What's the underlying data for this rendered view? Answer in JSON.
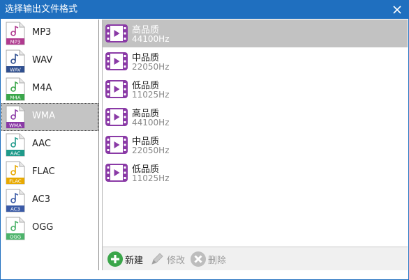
{
  "window": {
    "title": "选择输出文件格式"
  },
  "formats": [
    {
      "label": "MP3",
      "badge": "MP3",
      "color": "#b03a8f"
    },
    {
      "label": "WAV",
      "badge": "WAV",
      "color": "#2f4f8f"
    },
    {
      "label": "M4A",
      "badge": "M4A",
      "color": "#3aa64a"
    },
    {
      "label": "WMA",
      "badge": "WMA",
      "color": "#8a3aa6",
      "selected": true
    },
    {
      "label": "AAC",
      "badge": "AAC",
      "color": "#1f9a8a"
    },
    {
      "label": "FLAC",
      "badge": "FLAC",
      "color": "#e8a900"
    },
    {
      "label": "AC3",
      "badge": "AC3",
      "color": "#3a5aa6"
    },
    {
      "label": "OGG",
      "badge": "OGG",
      "color": "#4cb36a"
    }
  ],
  "presets": [
    {
      "name": "高品质",
      "rate": "44100Hz",
      "selected": true
    },
    {
      "name": "中品质",
      "rate": "22050Hz"
    },
    {
      "name": "低品质",
      "rate": "11025Hz"
    },
    {
      "name": "高品质",
      "rate": "44100Hz"
    },
    {
      "name": "中品质",
      "rate": "22050Hz"
    },
    {
      "name": "低品质",
      "rate": "11025Hz"
    }
  ],
  "toolbar": {
    "new_label": "新建",
    "edit_label": "修改",
    "delete_label": "删除"
  },
  "colors": {
    "titlebar": "#1f6fbf",
    "preset_icon": "#8a3aa6",
    "new_green": "#3aa64a"
  }
}
